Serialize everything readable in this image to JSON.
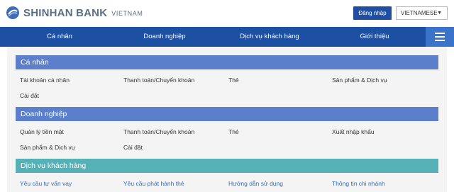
{
  "header": {
    "logo_text": "SHINHAN BANK",
    "logo_sub": "VIETNAM",
    "login_label": "Đăng nhập",
    "language": "VIETNAMESE"
  },
  "nav": {
    "items": [
      "Cá nhân",
      "Doanh nghiệp",
      "Dịch vụ khách hàng",
      "Giới thiệu"
    ]
  },
  "sections": [
    {
      "title": "Cá nhân",
      "links": [
        "Tài khoản cá nhân",
        "Thanh toán/Chuyển khoản",
        "Thẻ",
        "Sản phẩm & Dịch vụ",
        "Cài đặt"
      ]
    },
    {
      "title": "Doanh nghiệp",
      "links": [
        "Quản lý tiền mặt",
        "Thanh toán/Chuyển khoản",
        "Thẻ",
        "Xuất nhập khẩu",
        "Sản phẩm & Dịch vụ",
        "Cài đặt"
      ]
    },
    {
      "title": "Dịch vụ khách hàng",
      "links": [
        "Yêu cầu tư vấn vay",
        "Yêu cầu phát hành thẻ",
        "Hướng dẫn sử dụng",
        "Thông tin chi nhánh"
      ]
    }
  ],
  "colors": {
    "nav": "#1d4fa3",
    "section_blue": "#5b7fca",
    "section_teal": "#56b1b6",
    "link_blue": "#2f6cc1"
  }
}
